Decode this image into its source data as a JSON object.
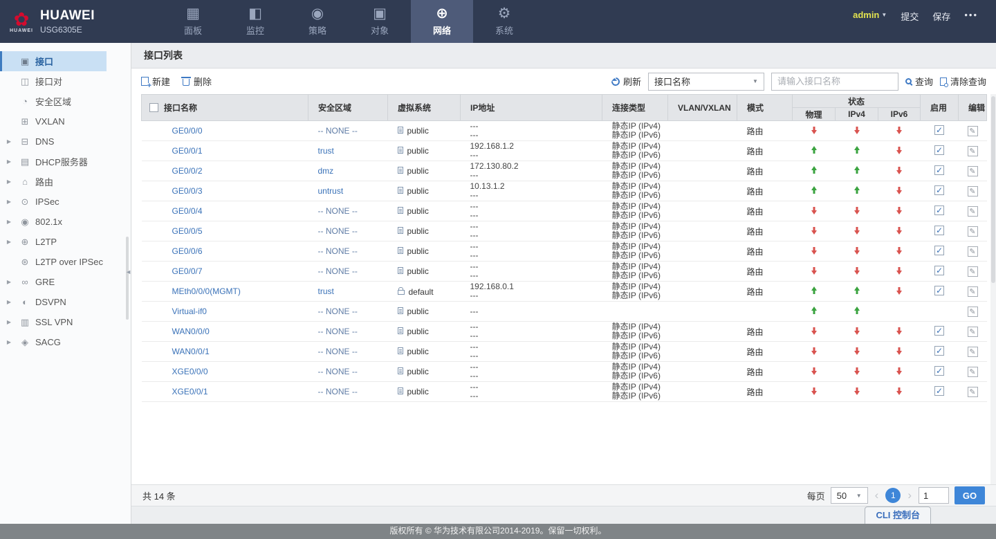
{
  "brand": {
    "name": "HUAWEI",
    "model": "USG6305E",
    "logo_caption": "HUAWEI"
  },
  "topnav": {
    "tabs": [
      {
        "id": "dashboard",
        "label": "面板",
        "icon": "dashboard-icon",
        "active": false
      },
      {
        "id": "monitor",
        "label": "监控",
        "icon": "monitor-icon",
        "active": false
      },
      {
        "id": "policy",
        "label": "策略",
        "icon": "policy-icon",
        "active": false
      },
      {
        "id": "object",
        "label": "对象",
        "icon": "object-icon",
        "active": false
      },
      {
        "id": "network",
        "label": "网络",
        "icon": "network-icon",
        "active": true
      },
      {
        "id": "system",
        "label": "系统",
        "icon": "system-icon",
        "active": false
      }
    ],
    "user": "admin",
    "submit": "提交",
    "save": "保存",
    "more": "•••"
  },
  "sidebar": {
    "items": [
      {
        "id": "interface",
        "label": "接口",
        "icon": "interface-icon",
        "selected": true,
        "expandable": false
      },
      {
        "id": "interface-pair",
        "label": "接口对",
        "icon": "interface-pair-icon",
        "selected": false,
        "expandable": false
      },
      {
        "id": "security-zone",
        "label": "安全区域",
        "icon": "security-zone-icon",
        "selected": false,
        "expandable": false
      },
      {
        "id": "vxlan",
        "label": "VXLAN",
        "icon": "vxlan-icon",
        "selected": false,
        "expandable": false
      },
      {
        "id": "dns",
        "label": "DNS",
        "icon": "dns-icon",
        "selected": false,
        "expandable": true
      },
      {
        "id": "dhcp-server",
        "label": "DHCP服务器",
        "icon": "dhcp-icon",
        "selected": false,
        "expandable": true
      },
      {
        "id": "route",
        "label": "路由",
        "icon": "route-icon",
        "selected": false,
        "expandable": true
      },
      {
        "id": "ipsec",
        "label": "IPSec",
        "icon": "ipsec-icon",
        "selected": false,
        "expandable": true
      },
      {
        "id": "dot1x",
        "label": "802.1x",
        "icon": "dot1x-icon",
        "selected": false,
        "expandable": true
      },
      {
        "id": "l2tp",
        "label": "L2TP",
        "icon": "l2tp-icon",
        "selected": false,
        "expandable": true
      },
      {
        "id": "l2tp-over-ipsec",
        "label": "L2TP over IPSec",
        "icon": "l2tp-ipsec-icon",
        "selected": false,
        "expandable": false
      },
      {
        "id": "gre",
        "label": "GRE",
        "icon": "gre-icon",
        "selected": false,
        "expandable": true
      },
      {
        "id": "dsvpn",
        "label": "DSVPN",
        "icon": "dsvpn-icon",
        "selected": false,
        "expandable": true
      },
      {
        "id": "sslvpn",
        "label": "SSL VPN",
        "icon": "sslvpn-icon",
        "selected": false,
        "expandable": true
      },
      {
        "id": "sacg",
        "label": "SACG",
        "icon": "sacg-icon",
        "selected": false,
        "expandable": true
      }
    ]
  },
  "main": {
    "title": "接口列表",
    "toolbar": {
      "new": "新建",
      "delete": "删除",
      "refresh": "刷新",
      "filter_selected": "接口名称",
      "search_placeholder": "请输入接口名称",
      "query": "查询",
      "clear_query": "清除查询"
    },
    "table": {
      "headers": {
        "name": "接口名称",
        "zone": "安全区域",
        "vsys": "虚拟系统",
        "ip": "IP地址",
        "conn": "连接类型",
        "vlan": "VLAN/VXLAN",
        "mode": "模式",
        "status": "状态",
        "phy": "物理",
        "ipv4": "IPv4",
        "ipv6": "IPv6",
        "enable": "启用",
        "edit": "编辑"
      },
      "rows": [
        {
          "name": "GE0/0/0",
          "zone": "-- NONE --",
          "zone_link": false,
          "vsys": "public",
          "vsys_icon": "vsys-public-icon",
          "ip": [
            "---",
            "---"
          ],
          "conn": [
            "静态IP (IPv4)",
            "静态IP (IPv6)"
          ],
          "vlan": "",
          "mode": "路由",
          "status": {
            "phy": "down",
            "ipv4": "down",
            "ipv6": "down"
          },
          "enabled": true
        },
        {
          "name": "GE0/0/1",
          "zone": "trust",
          "zone_link": true,
          "vsys": "public",
          "vsys_icon": "vsys-public-icon",
          "ip": [
            "192.168.1.2",
            "---"
          ],
          "conn": [
            "静态IP (IPv4)",
            "静态IP (IPv6)"
          ],
          "vlan": "",
          "mode": "路由",
          "status": {
            "phy": "up",
            "ipv4": "up",
            "ipv6": "down"
          },
          "enabled": true
        },
        {
          "name": "GE0/0/2",
          "zone": "dmz",
          "zone_link": true,
          "vsys": "public",
          "vsys_icon": "vsys-public-icon",
          "ip": [
            "172.130.80.2",
            "---"
          ],
          "conn": [
            "静态IP (IPv4)",
            "静态IP (IPv6)"
          ],
          "vlan": "",
          "mode": "路由",
          "status": {
            "phy": "up",
            "ipv4": "up",
            "ipv6": "down"
          },
          "enabled": true
        },
        {
          "name": "GE0/0/3",
          "zone": "untrust",
          "zone_link": true,
          "vsys": "public",
          "vsys_icon": "vsys-public-icon",
          "ip": [
            "10.13.1.2",
            "---"
          ],
          "conn": [
            "静态IP (IPv4)",
            "静态IP (IPv6)"
          ],
          "vlan": "",
          "mode": "路由",
          "status": {
            "phy": "up",
            "ipv4": "up",
            "ipv6": "down"
          },
          "enabled": true
        },
        {
          "name": "GE0/0/4",
          "zone": "-- NONE --",
          "zone_link": false,
          "vsys": "public",
          "vsys_icon": "vsys-public-icon",
          "ip": [
            "---",
            "---"
          ],
          "conn": [
            "静态IP (IPv4)",
            "静态IP (IPv6)"
          ],
          "vlan": "",
          "mode": "路由",
          "status": {
            "phy": "down",
            "ipv4": "down",
            "ipv6": "down"
          },
          "enabled": true
        },
        {
          "name": "GE0/0/5",
          "zone": "-- NONE --",
          "zone_link": false,
          "vsys": "public",
          "vsys_icon": "vsys-public-icon",
          "ip": [
            "---",
            "---"
          ],
          "conn": [
            "静态IP (IPv4)",
            "静态IP (IPv6)"
          ],
          "vlan": "",
          "mode": "路由",
          "status": {
            "phy": "down",
            "ipv4": "down",
            "ipv6": "down"
          },
          "enabled": true
        },
        {
          "name": "GE0/0/6",
          "zone": "-- NONE --",
          "zone_link": false,
          "vsys": "public",
          "vsys_icon": "vsys-public-icon",
          "ip": [
            "---",
            "---"
          ],
          "conn": [
            "静态IP (IPv4)",
            "静态IP (IPv6)"
          ],
          "vlan": "",
          "mode": "路由",
          "status": {
            "phy": "down",
            "ipv4": "down",
            "ipv6": "down"
          },
          "enabled": true
        },
        {
          "name": "GE0/0/7",
          "zone": "-- NONE --",
          "zone_link": false,
          "vsys": "public",
          "vsys_icon": "vsys-public-icon",
          "ip": [
            "---",
            "---"
          ],
          "conn": [
            "静态IP (IPv4)",
            "静态IP (IPv6)"
          ],
          "vlan": "",
          "mode": "路由",
          "status": {
            "phy": "down",
            "ipv4": "down",
            "ipv6": "down"
          },
          "enabled": true
        },
        {
          "name": "MEth0/0/0(MGMT)",
          "zone": "trust",
          "zone_link": true,
          "vsys": "default",
          "vsys_icon": "lock-open-icon",
          "ip": [
            "192.168.0.1",
            "---"
          ],
          "conn": [
            "静态IP (IPv4)",
            "静态IP (IPv6)"
          ],
          "vlan": "",
          "mode": "路由",
          "status": {
            "phy": "up",
            "ipv4": "up",
            "ipv6": "down"
          },
          "enabled": true
        },
        {
          "name": "Virtual-if0",
          "zone": "-- NONE --",
          "zone_link": false,
          "vsys": "public",
          "vsys_icon": "vsys-public-icon",
          "ip": [
            "---"
          ],
          "conn": [],
          "vlan": "",
          "mode": "",
          "status": {
            "phy": "up",
            "ipv4": "up",
            "ipv6": "none"
          },
          "enabled": false
        },
        {
          "name": "WAN0/0/0",
          "zone": "-- NONE --",
          "zone_link": false,
          "vsys": "public",
          "vsys_icon": "vsys-public-icon",
          "ip": [
            "---",
            "---"
          ],
          "conn": [
            "静态IP (IPv4)",
            "静态IP (IPv6)"
          ],
          "vlan": "",
          "mode": "路由",
          "status": {
            "phy": "down",
            "ipv4": "down",
            "ipv6": "down"
          },
          "enabled": true
        },
        {
          "name": "WAN0/0/1",
          "zone": "-- NONE --",
          "zone_link": false,
          "vsys": "public",
          "vsys_icon": "vsys-public-icon",
          "ip": [
            "---",
            "---"
          ],
          "conn": [
            "静态IP (IPv4)",
            "静态IP (IPv6)"
          ],
          "vlan": "",
          "mode": "路由",
          "status": {
            "phy": "down",
            "ipv4": "down",
            "ipv6": "down"
          },
          "enabled": true
        },
        {
          "name": "XGE0/0/0",
          "zone": "-- NONE --",
          "zone_link": false,
          "vsys": "public",
          "vsys_icon": "vsys-public-icon",
          "ip": [
            "---",
            "---"
          ],
          "conn": [
            "静态IP (IPv4)",
            "静态IP (IPv6)"
          ],
          "vlan": "",
          "mode": "路由",
          "status": {
            "phy": "down",
            "ipv4": "down",
            "ipv6": "down"
          },
          "enabled": true
        },
        {
          "name": "XGE0/0/1",
          "zone": "-- NONE --",
          "zone_link": false,
          "vsys": "public",
          "vsys_icon": "vsys-public-icon",
          "ip": [
            "---",
            "---"
          ],
          "conn": [
            "静态IP (IPv4)",
            "静态IP (IPv6)"
          ],
          "vlan": "",
          "mode": "路由",
          "status": {
            "phy": "down",
            "ipv4": "down",
            "ipv6": "down"
          },
          "enabled": true
        }
      ]
    },
    "pagination": {
      "total": "共 14 条",
      "per_page_label": "每页",
      "per_page": "50",
      "page": "1",
      "page_input": "1",
      "go": "GO"
    },
    "cli_button": "CLI 控制台"
  },
  "footer": {
    "copyright": "版权所有 © 华为技术有限公司2014-2019。保留一切权利。"
  },
  "colors": {
    "accent_blue": "#3e79c4",
    "link_blue": "#3a72b8",
    "up_green": "#3aa33f",
    "down_red": "#d9534f",
    "nav_bg": "#303b52",
    "nav_active_bg": "#4e5b79",
    "huawei_red": "#d40b2e",
    "admin_yellow": "#e3e34f"
  }
}
